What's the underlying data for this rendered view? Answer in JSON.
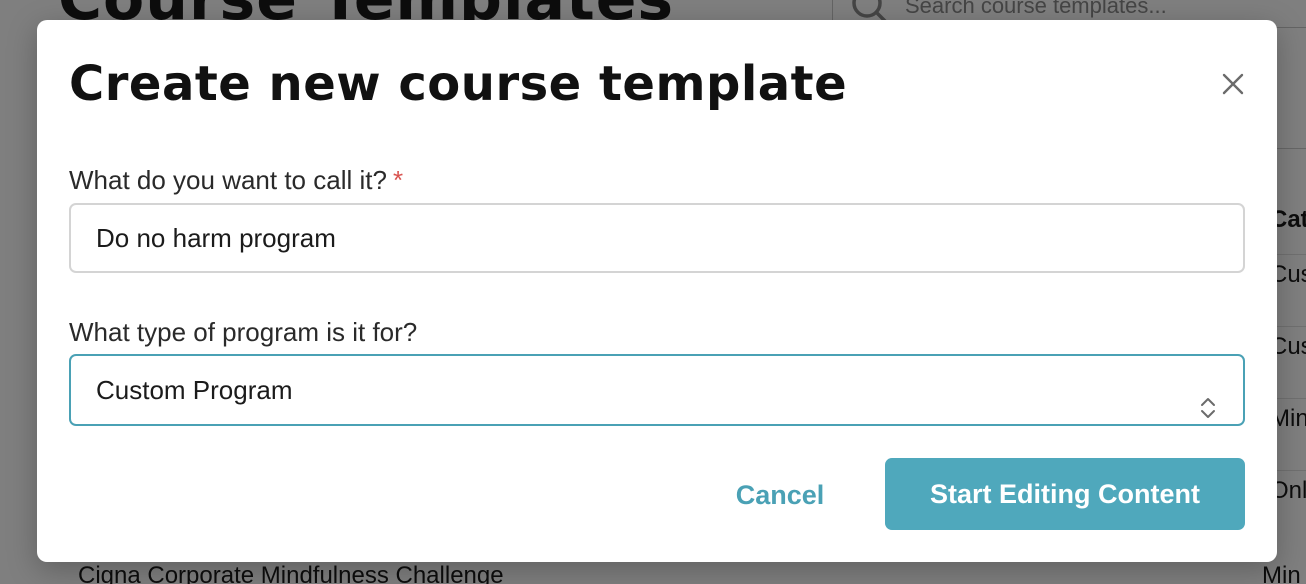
{
  "background": {
    "page_title": "Course Templates",
    "search_placeholder": "Search course templates...",
    "column_cells": [
      "Cat",
      "Cus",
      "Cus",
      "Min",
      "Onl"
    ],
    "bottom_row_name": "Cigna Corporate Mindfulness Challenge",
    "bottom_row_category": "Min"
  },
  "modal": {
    "title": "Create new course template",
    "close_icon": "close-icon",
    "name_field": {
      "label": "What do you want to call it?",
      "required_mark": "*",
      "value": "Do no harm program"
    },
    "type_field": {
      "label": "What type of program is it for?",
      "value": "Custom Program",
      "icon": "chevron-up-down-icon"
    },
    "cancel_label": "Cancel",
    "submit_label": "Start Editing Content"
  },
  "colors": {
    "accent": "#4fa8bc",
    "required": "#d9534f",
    "overlay": "rgba(0,0,0,0.5)"
  }
}
